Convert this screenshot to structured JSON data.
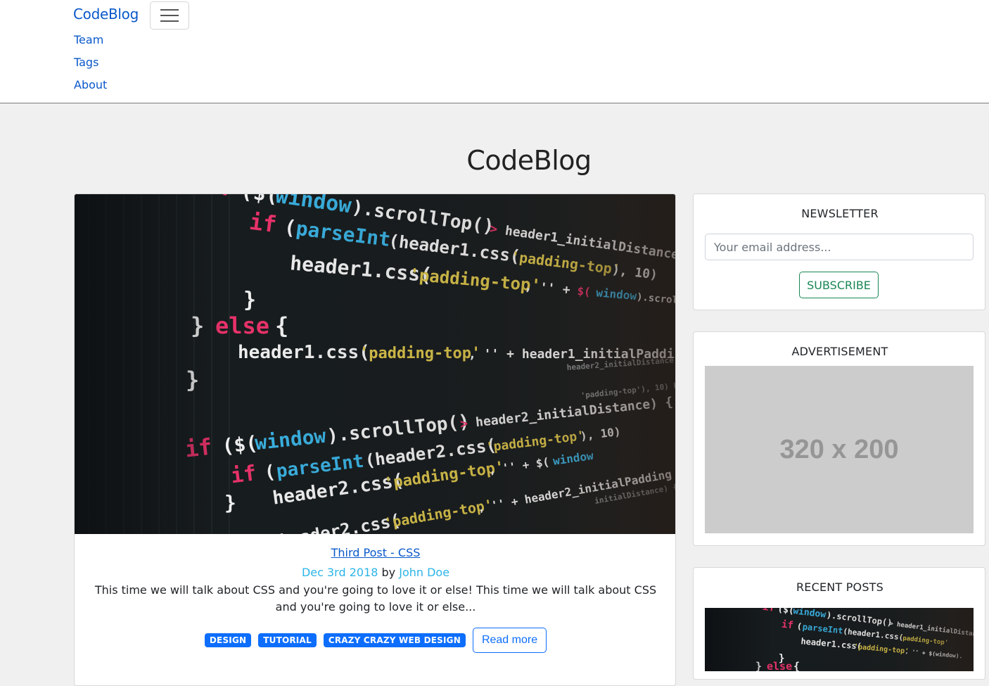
{
  "navbar": {
    "brand": "CodeBlog",
    "toggle_label": "Toggle navigation",
    "links": [
      {
        "label": "Team"
      },
      {
        "label": "Tags"
      },
      {
        "label": "About"
      }
    ]
  },
  "hero": {
    "title": "CodeBlog"
  },
  "post": {
    "title": "Third Post - CSS",
    "date": "Dec 3rd 2018",
    "by": "by",
    "author": "John Doe",
    "excerpt": "This time we will talk about CSS and you're going to love it or else! This time we will talk about CSS and you're going to love it or else...",
    "tags": [
      "DESIGN",
      "TUTORIAL",
      "CRAZY CRAZY WEB DESIGN"
    ],
    "read_more": "Read more",
    "image_icon": "code-screenshot-image"
  },
  "sidebar": {
    "newsletter": {
      "heading": "NEWSLETTER",
      "email_placeholder": "Your email address...",
      "email_value": "",
      "subscribe_label": "SUBSCRIBE"
    },
    "advertisement": {
      "heading": "ADVERTISEMENT",
      "placeholder_text": "320 x 200"
    },
    "recent_posts": {
      "heading": "RECENT POSTS"
    }
  },
  "colors": {
    "link": "#0a58ca",
    "primary": "#0d6efd",
    "success": "#198754",
    "accent_meta": "#2bb5e8",
    "page_bg": "#f0f0f0"
  }
}
